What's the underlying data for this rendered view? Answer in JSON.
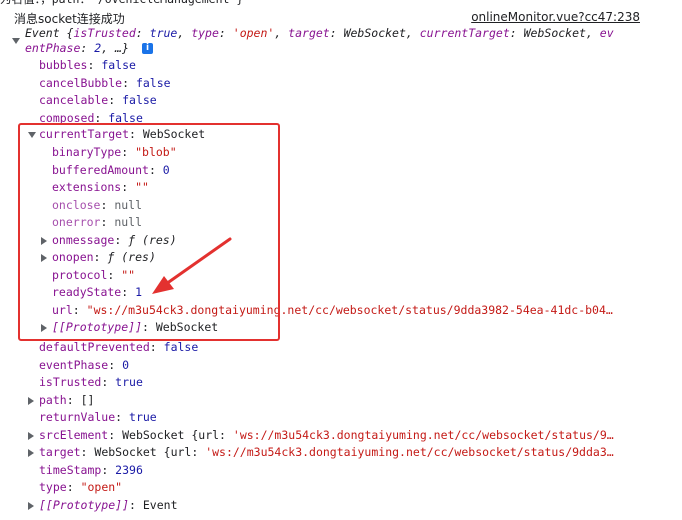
{
  "top_cut_text": "为名值：，path：'/oVehicleManagement'}",
  "console": {
    "message": "消息socket连接成功",
    "source_link": "onlineMonitor.vue?cc47:238"
  },
  "event_summary": {
    "line1_prefix": "Event {",
    "line1_key1": "isTrusted",
    "line1_val1": "true",
    "line1_key2": "type",
    "line1_val2": "'open'",
    "line1_key3": "target",
    "line1_val3": "WebSocket",
    "line1_key4": "currentTarget",
    "line1_val4": "WebSocket",
    "line1_key5_partial": "ev",
    "line2_key": "entPhase",
    "line2_val": "2",
    "line2_suffix": ", …}",
    "info_icon": "i"
  },
  "properties_before": [
    {
      "key": "bubbles",
      "value": "false",
      "kind": "lit"
    },
    {
      "key": "cancelBubble",
      "value": "false",
      "kind": "lit"
    },
    {
      "key": "cancelable",
      "value": "false",
      "kind": "lit"
    },
    {
      "key": "composed",
      "value": "false",
      "kind": "lit"
    }
  ],
  "current_target": {
    "key": "currentTarget",
    "value": "WebSocket",
    "children": [
      {
        "key": "binaryType",
        "value": "\"blob\"",
        "kind": "str",
        "expandable": false
      },
      {
        "key": "bufferedAmount",
        "value": "0",
        "kind": "lit",
        "expandable": false
      },
      {
        "key": "extensions",
        "value": "\"\"",
        "kind": "str",
        "expandable": false
      },
      {
        "key": "onclose",
        "value": "null",
        "kind": "null",
        "expandable": false
      },
      {
        "key": "onerror",
        "value": "null",
        "kind": "null",
        "expandable": false
      },
      {
        "key": "onmessage",
        "value": "ƒ (res)",
        "kind": "fn",
        "expandable": true
      },
      {
        "key": "onopen",
        "value": "ƒ (res)",
        "kind": "fn",
        "expandable": true
      },
      {
        "key": "protocol",
        "value": "\"\"",
        "kind": "str",
        "expandable": false
      },
      {
        "key": "readyState",
        "value": "1",
        "kind": "lit",
        "expandable": false
      },
      {
        "key": "url",
        "value": "\"ws://m3u54ck3.dongtaiyuming.net/cc/websocket/status/9dda3982-54ea-41dc-b04…",
        "kind": "str",
        "expandable": false
      },
      {
        "key": "[[Prototype]]",
        "value": "WebSocket",
        "kind": "proto",
        "expandable": true
      }
    ]
  },
  "properties_after": [
    {
      "key": "defaultPrevented",
      "value": "false",
      "kind": "lit",
      "expandable": false
    },
    {
      "key": "eventPhase",
      "value": "0",
      "kind": "lit",
      "expandable": false
    },
    {
      "key": "isTrusted",
      "value": "true",
      "kind": "lit",
      "expandable": false
    },
    {
      "key": "path",
      "value": "[]",
      "kind": "obj",
      "expandable": true
    },
    {
      "key": "returnValue",
      "value": "true",
      "kind": "lit",
      "expandable": false
    },
    {
      "key": "srcElement",
      "value": "WebSocket {url: 'ws://m3u54ck3.dongtaiyuming.net/cc/websocket/status/9…",
      "kind": "mixed",
      "expandable": true
    },
    {
      "key": "target",
      "value": "WebSocket {url: 'ws://m3u54ck3.dongtaiyuming.net/cc/websocket/status/9dda3…",
      "kind": "mixed",
      "expandable": true
    },
    {
      "key": "timeStamp",
      "value": "2396",
      "kind": "lit",
      "expandable": false
    },
    {
      "key": "type",
      "value": "\"open\"",
      "kind": "str",
      "expandable": false
    },
    {
      "key": "[[Prototype]]",
      "value": "Event",
      "kind": "proto",
      "expandable": true
    }
  ],
  "annotation": {
    "box_color": "#e3312f",
    "arrow_color": "#e3312f"
  }
}
